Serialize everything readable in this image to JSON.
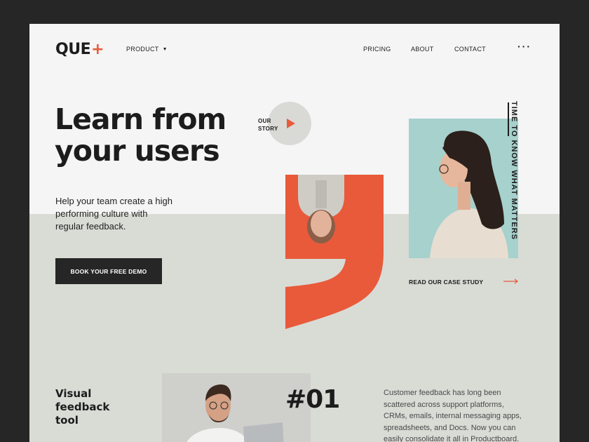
{
  "brand": {
    "logo_text": "QUE",
    "logo_mark": "+",
    "accent": "#e85a3a"
  },
  "nav": {
    "product": "PRODUCT",
    "pricing": "PRICING",
    "about": "ABOUT",
    "contact": "CONTACT",
    "more_icon": "more-dots-icon"
  },
  "hero": {
    "headline": "Learn from your users",
    "subtext": "Help your team create a high performing culture with regular feedback.",
    "cta": "BOOK YOUR FREE DEMO",
    "story_label": "OUR STORY",
    "vertical_text": "TIME TO KNOW WHAT MATTERS",
    "case_study": "READ OUR CASE STUDY"
  },
  "feature": {
    "title": "Visual feedback tool",
    "number": "#01",
    "description": "Customer feedback has long been scattered across support platforms, CRMs, emails, internal messaging apps, spreadsheets, and Docs. Now you can easily consolidate it all in Productboard."
  },
  "colors": {
    "dark": "#262626",
    "band": "#d9dbd5",
    "teal": "#a6d1cd",
    "orange": "#e85a3a"
  }
}
